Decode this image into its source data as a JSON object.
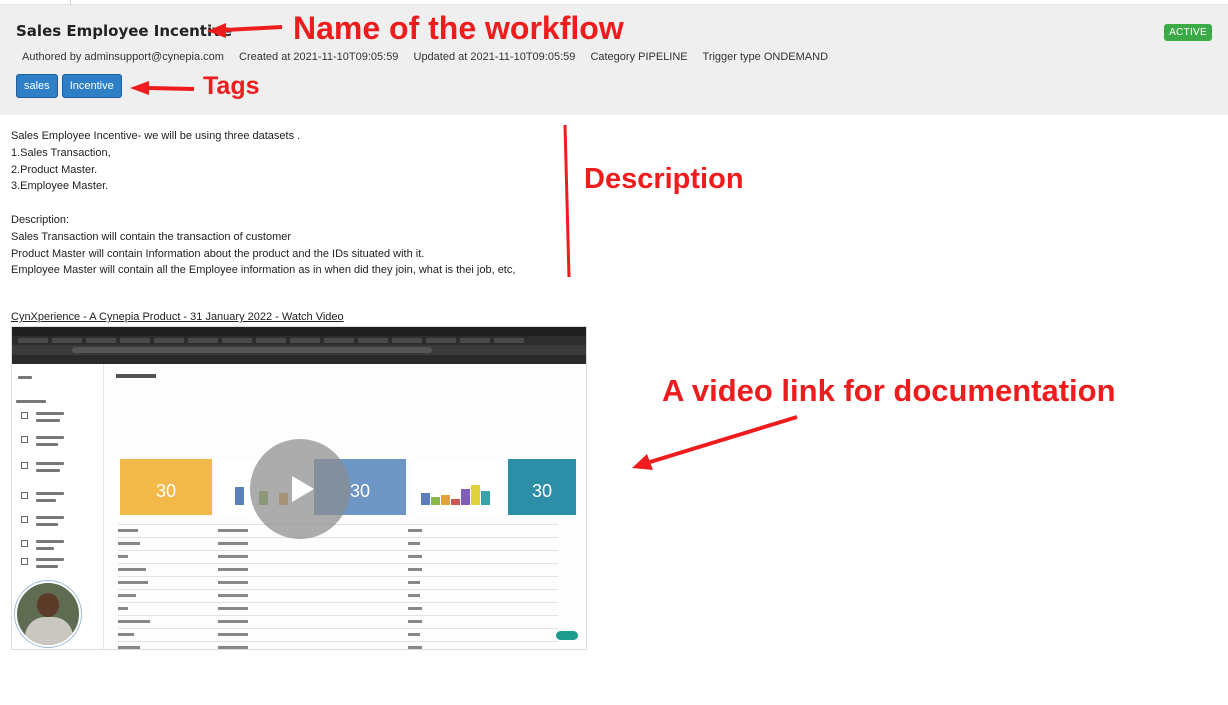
{
  "workflow": {
    "title": "Sales Employee Incentive",
    "status": "ACTIVE",
    "meta": {
      "author": "Authored by adminsupport@cynepia.com",
      "created": "Created at 2021-11-10T09:05:59",
      "updated": "Updated at 2021-11-10T09:05:59",
      "category": "Category PIPELINE",
      "trigger": "Trigger type ONDEMAND"
    },
    "tags": [
      "sales",
      "Incentive"
    ]
  },
  "description": {
    "lines_a": [
      "Sales Employee Incentive- we will be using three datasets .",
      "1.Sales Transaction,",
      "2.Product Master.",
      "3.Employee Master."
    ],
    "lines_b": [
      "Description:",
      "Sales Transaction will contain the transaction of customer",
      "Product Master will contain Information about the product and the IDs situated with it.",
      "Employee Master will contain all the Employee information as in when did they join, what is thei job, etc,"
    ]
  },
  "video": {
    "link_text": "CynXperience - A Cynepia Product - 31 January 2022 - Watch Video",
    "thumbnail_cards": [
      "30",
      "30",
      "30"
    ]
  },
  "annotations": {
    "name": "Name of the workflow",
    "tags": "Tags",
    "description": "Description",
    "video": "A video link for documentation"
  },
  "colors": {
    "header_bg": "#efefef",
    "active_badge": "#3daa48",
    "tag": "#2f7fc6",
    "annotation": "#ee1c1c"
  },
  "icons": [
    "play-icon",
    "arrow-icon"
  ]
}
